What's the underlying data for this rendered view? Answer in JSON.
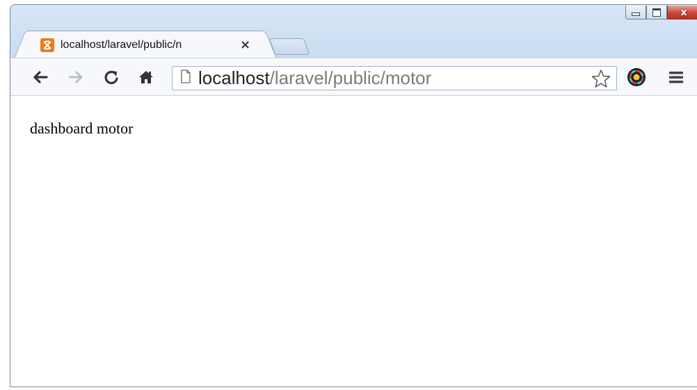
{
  "window": {
    "controls": {
      "minimize_icon": "minimize-icon",
      "maximize_icon": "maximize-icon",
      "close_glyph": "x"
    }
  },
  "tab": {
    "favicon": "xampp-icon",
    "title": "localhost/laravel/public/n",
    "close_glyph": "×"
  },
  "toolbar": {
    "back_icon": "back-arrow-icon",
    "forward_icon": "forward-arrow-icon",
    "reload_icon": "reload-icon",
    "home_icon": "home-icon",
    "url_host": "localhost",
    "url_path": "/laravel/public/motor",
    "bookmark_icon": "star-icon",
    "extension_icon": "extension-icon",
    "menu_icon": "hamburger-menu-icon"
  },
  "page": {
    "text": "dashboard motor"
  },
  "colors": {
    "favicon": "#f07a1a",
    "close_button": "#c9483a",
    "frame": "#bcd3ee"
  }
}
